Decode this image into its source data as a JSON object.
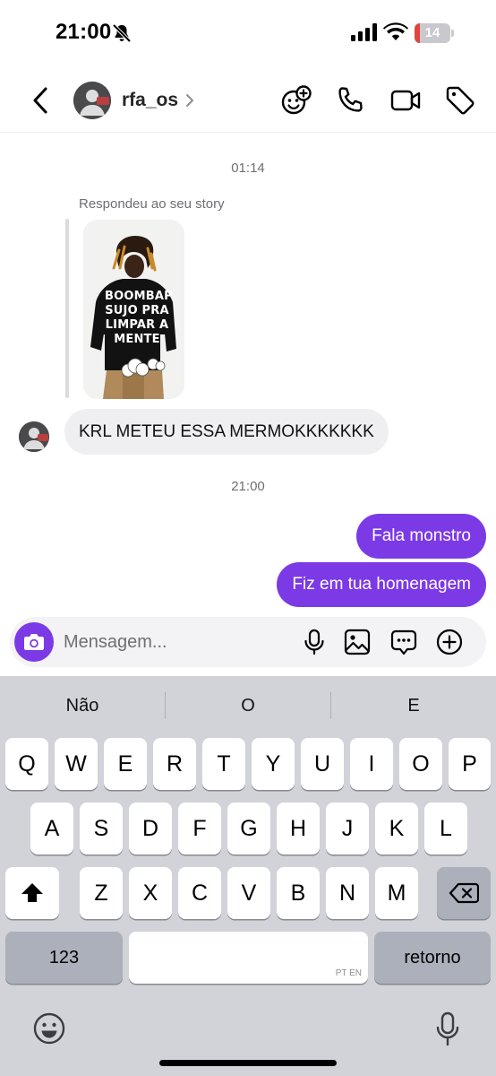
{
  "status_bar": {
    "time": "21:00",
    "battery_level": "14",
    "battery_fraction": 0.14,
    "battery_color": "#e0443e",
    "icons": [
      "bell-slash-icon",
      "cellular-signal-icon",
      "wifi-icon",
      "battery-icon"
    ]
  },
  "header": {
    "username": "rfa_os",
    "icons": [
      "back-arrow-icon",
      "chevron-right-icon",
      "effects-icon",
      "phone-icon",
      "video-camera-icon",
      "tag-icon"
    ]
  },
  "conversation": {
    "timestamp_1": "01:14",
    "reply_label": "Respondeu ao seu story",
    "story_shirt_text": "BOOMBAP SUJO PRA LIMPAR A MENTE",
    "incoming_message": "KRL METEU ESSA MERMOKKKKKKK",
    "timestamp_2": "21:00",
    "outgoing_messages": [
      "Fala monstro",
      "Fiz em tua homenagem"
    ],
    "outgoing_color": "#7c3ae6"
  },
  "composer": {
    "placeholder": "Mensagem...",
    "value": "",
    "icons": [
      "camera-icon",
      "microphone-icon",
      "gallery-icon",
      "sticker-icon",
      "plus-circle-icon"
    ]
  },
  "keyboard": {
    "suggestions": [
      "Não",
      "O",
      "E"
    ],
    "row1": [
      "Q",
      "W",
      "E",
      "R",
      "T",
      "Y",
      "U",
      "I",
      "O",
      "P"
    ],
    "row2": [
      "A",
      "S",
      "D",
      "F",
      "G",
      "H",
      "J",
      "K",
      "L"
    ],
    "row3": [
      "Z",
      "X",
      "C",
      "V",
      "B",
      "N",
      "M"
    ],
    "numbers_key": "123",
    "return_key": "retorno",
    "space_languages": "PT EN",
    "icons": [
      "shift-icon",
      "delete-icon",
      "emoji-icon",
      "dictation-icon"
    ]
  }
}
